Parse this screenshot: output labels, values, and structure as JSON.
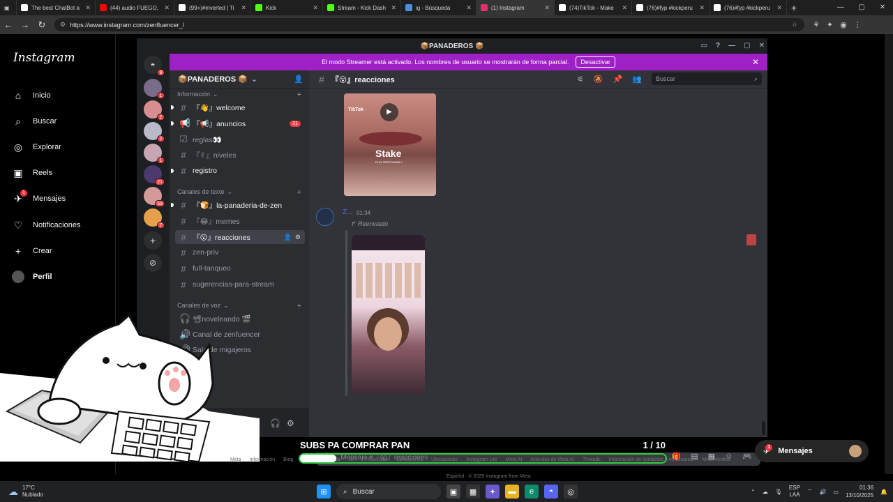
{
  "browser": {
    "tabs": [
      {
        "label": "The best ChatBot a",
        "color": "#ffffff"
      },
      {
        "label": "(44) audio FUEGO,",
        "color": "#ff0000"
      },
      {
        "label": "(99+)#inverted | Ti",
        "color": "#ffffff"
      },
      {
        "label": "Kick",
        "color": "#53fc18"
      },
      {
        "label": "Stream - Kick Dash",
        "color": "#53fc18"
      },
      {
        "label": "ig - Búsqueda",
        "color": "#4a90e2"
      },
      {
        "label": "(1) Instagram",
        "color": "#e1306c"
      },
      {
        "label": "(74)TikTok - Make",
        "color": "#ffffff"
      },
      {
        "label": "(76)#fyp #kickperu",
        "color": "#ffffff"
      },
      {
        "label": "(76)#fyp #kickperu",
        "color": "#ffffff"
      }
    ],
    "url": "https://www.instagram.com/zenfluencer_/"
  },
  "instagram": {
    "logo": "Instagram",
    "nav": [
      {
        "label": "Inicio",
        "icon": "home-icon"
      },
      {
        "label": "Buscar",
        "icon": "search-icon"
      },
      {
        "label": "Explorar",
        "icon": "compass-icon"
      },
      {
        "label": "Reels",
        "icon": "reels-icon"
      },
      {
        "label": "Mensajes",
        "icon": "messenger-icon",
        "badge": "1"
      },
      {
        "label": "Notificaciones",
        "icon": "heart-icon"
      },
      {
        "label": "Crear",
        "icon": "plus-icon"
      },
      {
        "label": "Perfil",
        "icon": "avatar"
      }
    ],
    "footer_links": [
      "Meta",
      "Información",
      "Blog",
      "Empleo",
      "Ayuda",
      "API",
      "Privacidad",
      "Condiciones",
      "Ubicaciones",
      "Instagram Lite",
      "Meta AI",
      "Artículos de Meta AI",
      "Threads",
      "Importación de contactos y no usuarios",
      "Meta Verified"
    ],
    "footer2": "Español  ·  © 2025 Instagram from Meta",
    "messages_pill": {
      "label": "Mensajes",
      "badge": "1"
    }
  },
  "discord": {
    "window_title": "📦PANADEROS 📦",
    "streamer_banner": "El modo Streamer está activado. Los nombres de usuario se mostrarán de forma parcial.",
    "streamer_button": "Desactivar",
    "server_name": "📦PANADEROS 📦",
    "guild_badges": [
      "9",
      "1",
      "2",
      "2",
      "1",
      "21",
      "58",
      "7"
    ],
    "categories": {
      "info": "Información",
      "text": "Canales de texto",
      "voice": "Canales de voz"
    },
    "channels": [
      {
        "label": "『👋』welcome",
        "icon": "#",
        "bright": true
      },
      {
        "label": "『📢』anuncios",
        "icon": "📢",
        "bright": true,
        "count": "21"
      },
      {
        "label": "reglas👀",
        "icon": "☑",
        "bright": false
      },
      {
        "label": "『✌』niveles",
        "icon": "#",
        "bright": false
      },
      {
        "label": "registro",
        "icon": "#",
        "bright": true
      },
      {
        "label": "『🍞』la-panaderia-de-zen",
        "icon": "#",
        "bright": true
      },
      {
        "label": "『😂』memes",
        "icon": "#",
        "bright": false
      },
      {
        "label": "『😮』reacciones",
        "icon": "#",
        "bright": true
      },
      {
        "label": "zen-priv",
        "icon": "#",
        "bright": false
      },
      {
        "label": "full-tanqueo",
        "icon": "#",
        "bright": false
      },
      {
        "label": "sugerencias-para-stream",
        "icon": "#",
        "bright": false
      },
      {
        "label": "📽noveleando 🎬",
        "icon": "🎧",
        "bright": false
      },
      {
        "label": "Canal de zenfuencer",
        "icon": "🔊",
        "bright": false
      },
      {
        "label": "Sala de migajeros",
        "icon": "🔊",
        "bright": false
      }
    ],
    "current_channel": "『😮』reacciones",
    "search_placeholder": "Buscar",
    "message": {
      "author": "Z...",
      "time": "01:34",
      "forwarded": "↱ Reenviado"
    },
    "media1": {
      "tiktok": "TikTok",
      "brand": "Stake",
      "tagline": "PLAY RESPONSIBLY"
    },
    "composer_placeholder": "Mensaje #『😮』reacciones"
  },
  "overlay": {
    "subs_text": "SUBS PA COMPRAR PAN",
    "subs_count": "1 / 10",
    "progress_fraction": 0.1
  },
  "taskbar": {
    "temp": "17°C",
    "weather": "Nublado",
    "search": "Buscar",
    "lang1": "ESP",
    "lang2": "LAA",
    "time": "01:36",
    "date": "13/10/2025"
  }
}
